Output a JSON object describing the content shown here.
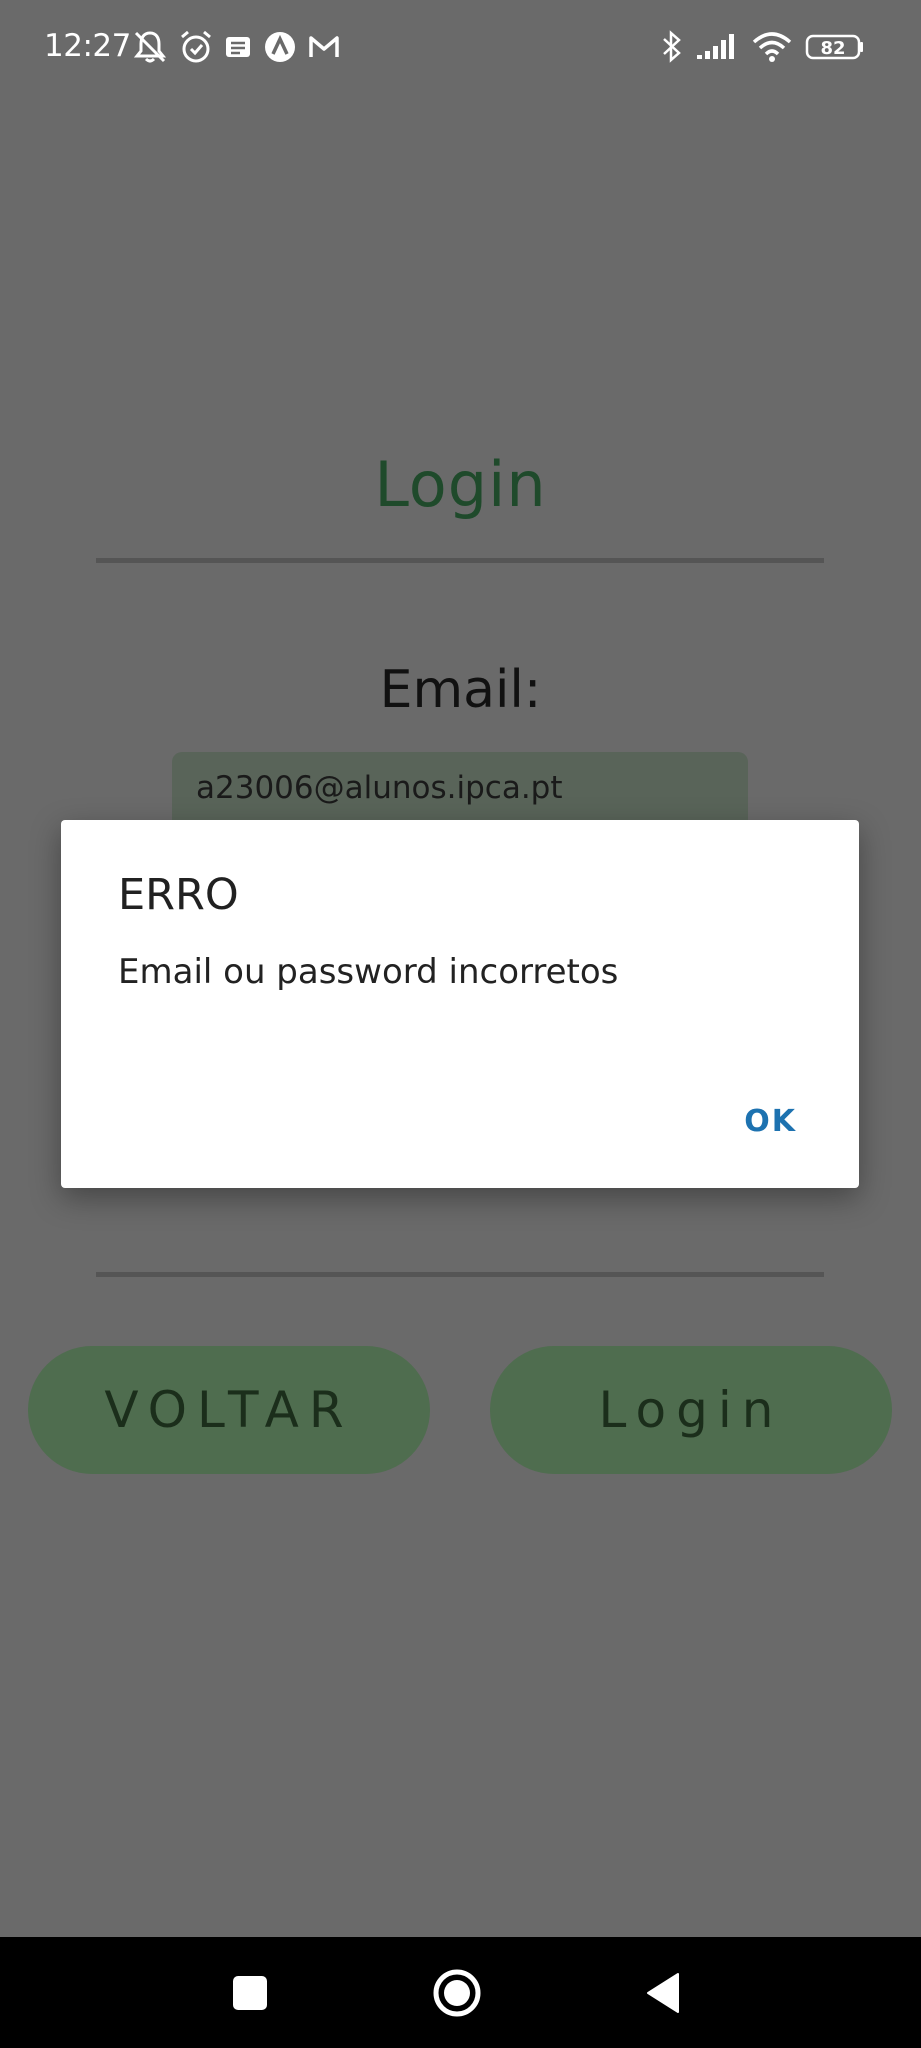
{
  "status_bar": {
    "time": "12:27",
    "battery_level": "82",
    "left_icons": [
      "muted-bell-icon",
      "alarm-icon",
      "notification-icon",
      "app-a-icon",
      "gmail-icon"
    ],
    "right_icons": [
      "bluetooth-icon",
      "signal-icon",
      "wifi-icon",
      "battery-icon"
    ]
  },
  "screen": {
    "title": "Login",
    "email_label": "Email:",
    "email_value": "a23006@alunos.ipca.pt",
    "back_button": "VOLTAR",
    "login_button": "Login"
  },
  "dialog": {
    "title": "ERRO",
    "message": "Email ou password incorretos",
    "ok_label": "OK"
  },
  "colors": {
    "overlay_background": "#6a6a6a",
    "title_color": "#1f4a2b",
    "button_green": "#4f6d4f",
    "dialog_accent": "#1d72b0"
  },
  "nav_bar": {
    "buttons": [
      "recents-icon",
      "home-icon",
      "back-icon"
    ]
  }
}
